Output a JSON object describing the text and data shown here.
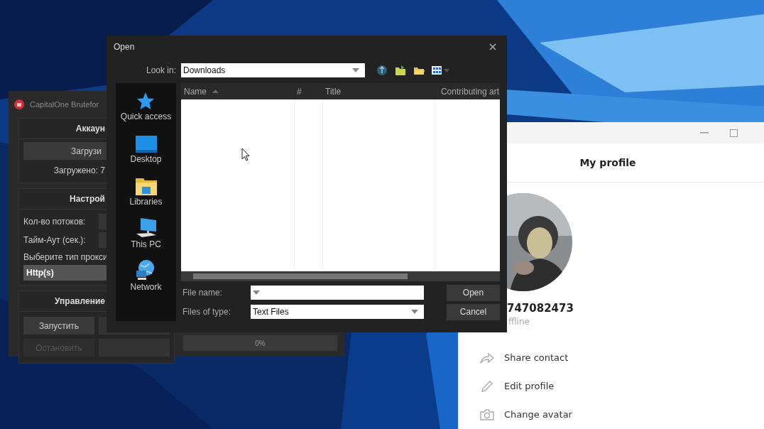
{
  "bruteforce_window": {
    "title": "CapitalOne Brutefor",
    "accounts": {
      "heading": "Аккаун",
      "load_button": "Загрузи",
      "loaded": "Загружено: 7"
    },
    "settings": {
      "heading": "Настрой",
      "threads_label": "Кол-во потоков:",
      "timeout_label": "Тайм-Аут (сек.):",
      "proxy_label": "Выберите тип прокси",
      "proxy_type": "Http(s)"
    },
    "control": {
      "heading": "Управление",
      "start_button": {
        "label": "Запустить",
        "disabled": false
      },
      "stop_button": {
        "label": "Остановить",
        "disabled": true
      }
    },
    "progress": {
      "label": "0%",
      "level": 0
    }
  },
  "open_dialog": {
    "title": "Open",
    "look_in_label": "Look in:",
    "look_in": "Downloads",
    "places": [
      {
        "label": "Quick access",
        "kind": "star"
      },
      {
        "label": "Desktop",
        "kind": "desktop"
      },
      {
        "label": "Libraries",
        "kind": "libraries"
      },
      {
        "label": "This PC",
        "kind": "pc"
      },
      {
        "label": "Network",
        "kind": "network"
      }
    ],
    "columns": [
      {
        "label": "Name",
        "sorted": true
      },
      {
        "label": "#",
        "sorted": false
      },
      {
        "label": "Title",
        "sorted": false
      },
      {
        "label": "Contributing art",
        "sorted": false
      }
    ],
    "file_name_label": "File name:",
    "file_type_label": "Files of type:",
    "file_type": "Text Files",
    "open_button": "Open",
    "cancel_button": "Cancel"
  },
  "profile_window": {
    "heading": "My profile",
    "phone": "747082473",
    "status": "ffline",
    "actions": [
      {
        "label": "Share contact",
        "kind": "share"
      },
      {
        "label": "Edit profile",
        "kind": "edit"
      },
      {
        "label": "Change avatar",
        "kind": "camera"
      }
    ]
  }
}
